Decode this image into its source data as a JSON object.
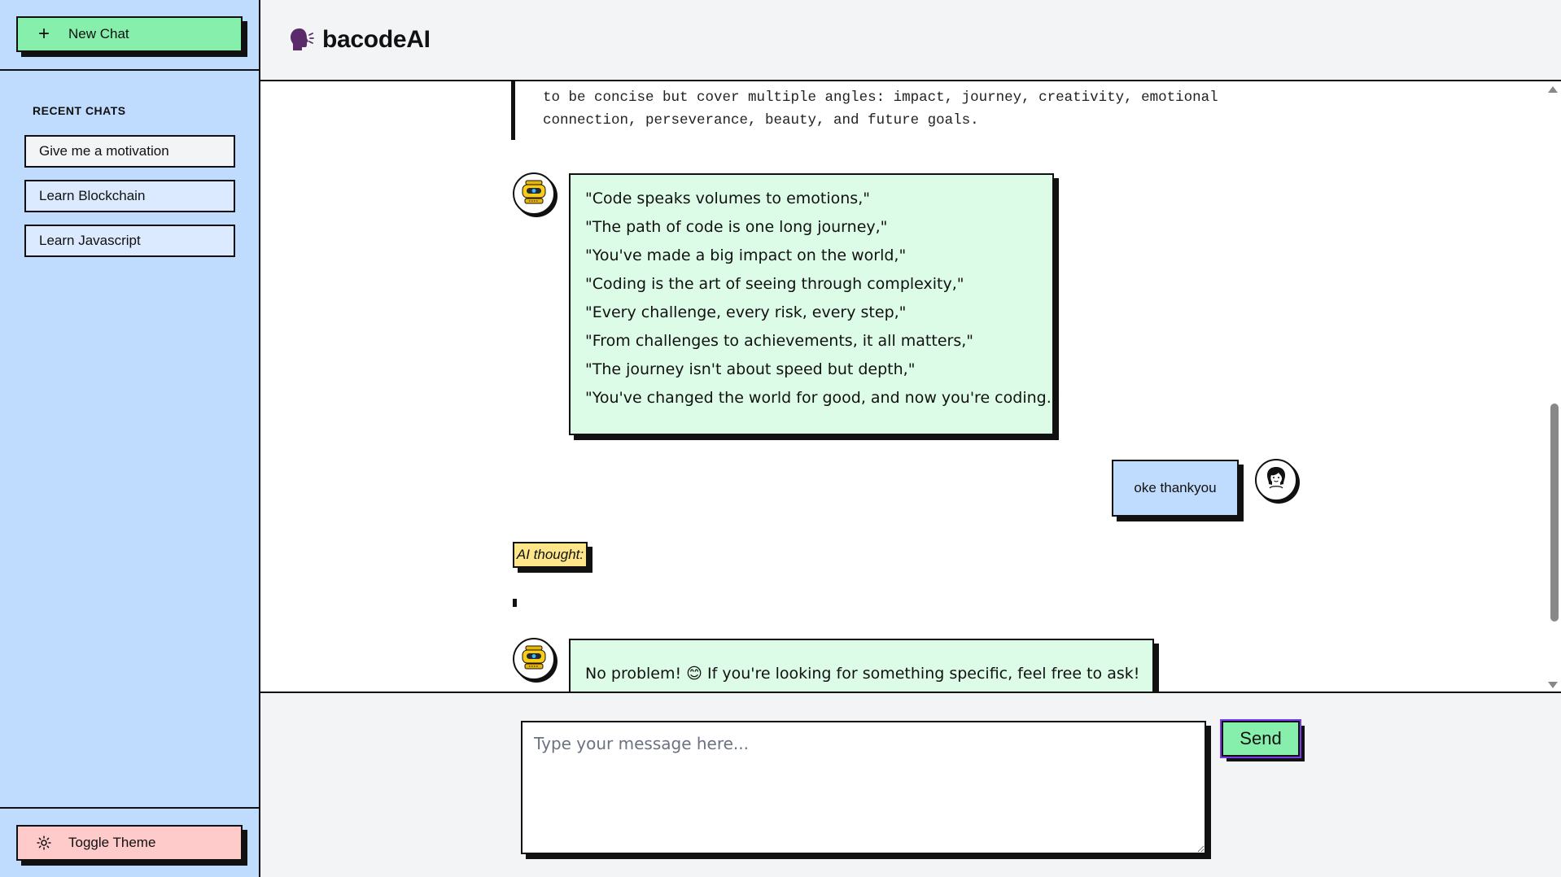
{
  "sidebar": {
    "new_chat_label": "New Chat",
    "recent_title": "RECENT CHATS",
    "chats": [
      {
        "label": "Give me a motivation"
      },
      {
        "label": "Learn Blockchain"
      },
      {
        "label": "Learn Javascript"
      }
    ],
    "toggle_theme_label": "Toggle Theme"
  },
  "header": {
    "brand": "bacodeAI"
  },
  "messages": {
    "thought_lines": [
      "to be concise but cover multiple angles: impact, journey, creativity, emotional",
      "connection, perseverance, beauty, and future goals."
    ],
    "ai_quotes": [
      "\"Code speaks volumes to emotions,\"",
      "\"The path of code is one long journey,\"",
      "\"You've made a big impact on the world,\"",
      "\"Coding is the art of seeing through complexity,\"",
      "\"Every challenge, every risk, every step,\"",
      "\"From challenges to achievements, it all matters,\"",
      "\"The journey isn't about speed but depth,\"",
      "\"You've changed the world for good, and now you're coding.\""
    ],
    "user_message": "oke thankyou",
    "ai_thought_label": "AI thought:",
    "ai_reply": "No problem! 😊 If you're looking for something specific, feel free to ask!"
  },
  "composer": {
    "placeholder": "Type your message here...",
    "value": "",
    "send_label": "Send"
  },
  "colors": {
    "sidebar_bg": "#bfdbfe",
    "new_chat_bg": "#86efac",
    "toggle_bg": "#fecaca",
    "ai_bubble_bg": "#dcfce7",
    "user_bubble_bg": "#bfdbfe",
    "thought_tag_bg": "#fde68a"
  },
  "icons": {
    "new_chat": "plus-icon",
    "toggle_theme": "sun-icon",
    "brand": "speaking-head-icon",
    "ai_avatar": "robot-icon",
    "user_avatar": "user-face-icon"
  }
}
